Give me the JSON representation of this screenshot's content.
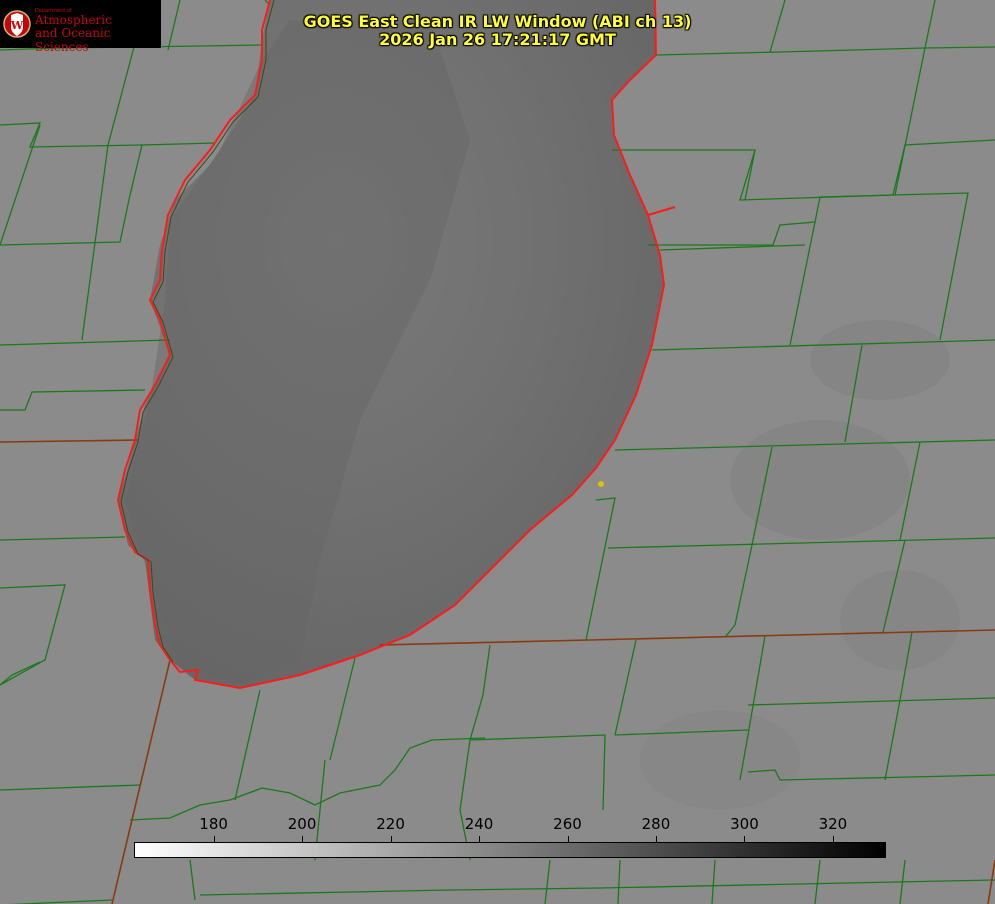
{
  "header": {
    "title": "GOES East Clean IR LW Window (ABI ch 13)",
    "timestamp": "2026 Jan 26 17:21:17 GMT"
  },
  "logo": {
    "department_small": "Department of",
    "line1": "Atmospheric",
    "line2": "and Oceanic Sciences",
    "seal_letter": "W"
  },
  "colorbar": {
    "ticks": [
      {
        "label": "180",
        "value": 180
      },
      {
        "label": "200",
        "value": 200
      },
      {
        "label": "220",
        "value": 220
      },
      {
        "label": "240",
        "value": 240
      },
      {
        "label": "260",
        "value": 260
      },
      {
        "label": "280",
        "value": 280
      },
      {
        "label": "300",
        "value": 300
      },
      {
        "label": "320",
        "value": 320
      }
    ],
    "range": [
      162,
      332
    ],
    "gradient": [
      "#ffffff",
      "#000000"
    ]
  },
  "colors": {
    "title": "#ffff33",
    "county_lines": "#1a7a1a",
    "state_lines": "#8a3a10",
    "coastline": "#ff1a1a",
    "lake": "#6a6a6a",
    "land": "#8a8a8a",
    "marker": "#e0c000"
  }
}
